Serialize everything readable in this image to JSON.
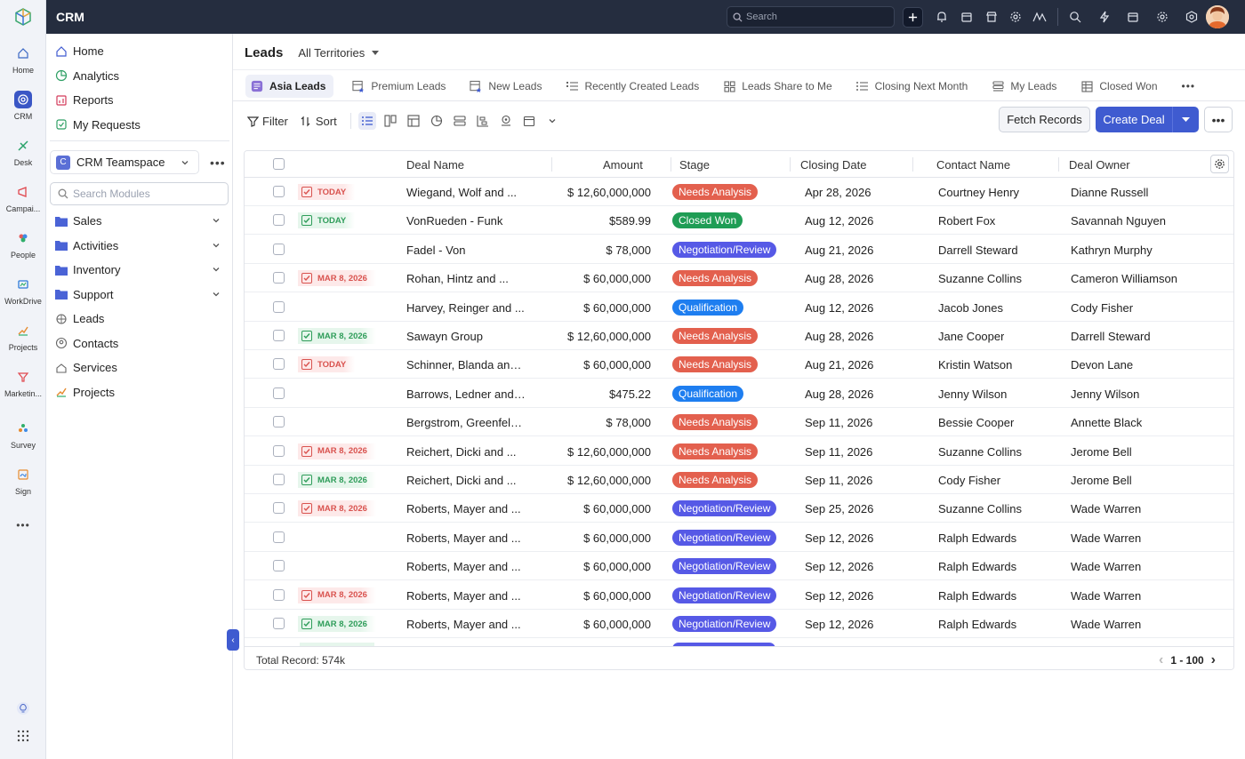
{
  "app": {
    "name": "CRM",
    "search_placeholder": "Search"
  },
  "rail": [
    {
      "label": "Home",
      "icon": "home-icon"
    },
    {
      "label": "CRM",
      "icon": "crm-icon",
      "active": true
    },
    {
      "label": "Desk",
      "icon": "desk-icon"
    },
    {
      "label": "Campai...",
      "icon": "campaigns-icon"
    },
    {
      "label": "People",
      "icon": "people-icon"
    },
    {
      "label": "WorkDrive",
      "icon": "workdrive-icon"
    },
    {
      "label": "Projects",
      "icon": "projects-icon"
    },
    {
      "label": "Marketin...",
      "icon": "marketing-icon"
    },
    {
      "label": "Survey",
      "icon": "survey-icon"
    },
    {
      "label": "Sign",
      "icon": "sign-icon"
    }
  ],
  "sidebar": {
    "top_items": [
      {
        "label": "Home",
        "icon": "home-icon"
      },
      {
        "label": "Analytics",
        "icon": "analytics-icon"
      },
      {
        "label": "Reports",
        "icon": "reports-icon"
      },
      {
        "label": "My Requests",
        "icon": "requests-icon"
      }
    ],
    "teamspace": {
      "badge": "C",
      "name": "CRM Teamspace"
    },
    "search_placeholder": "Search Modules",
    "folders": [
      {
        "label": "Sales"
      },
      {
        "label": "Activities"
      },
      {
        "label": "Inventory"
      },
      {
        "label": "Support"
      }
    ],
    "modules": [
      {
        "label": "Leads",
        "icon": "leads-icon"
      },
      {
        "label": "Contacts",
        "icon": "contacts-icon"
      },
      {
        "label": "Services",
        "icon": "services-icon"
      },
      {
        "label": "Projects",
        "icon": "projects-icon"
      }
    ]
  },
  "header": {
    "title": "Leads",
    "territory": "All Territories"
  },
  "tabs": [
    {
      "label": "Asia Leads",
      "active": true
    },
    {
      "label": "Premium Leads"
    },
    {
      "label": "New Leads"
    },
    {
      "label": "Recently Created Leads"
    },
    {
      "label": "Leads Share to Me"
    },
    {
      "label": "Closing Next Month"
    },
    {
      "label": "My Leads"
    },
    {
      "label": "Closed Won"
    }
  ],
  "toolbar": {
    "filter": "Filter",
    "sort": "Sort",
    "fetch": "Fetch Records",
    "create": "Create Deal"
  },
  "columns": {
    "deal_name": "Deal Name",
    "amount": "Amount",
    "stage": "Stage",
    "closing_date": "Closing Date",
    "contact_name": "Contact Name",
    "deal_owner": "Deal Owner"
  },
  "stage_colors": {
    "Needs Analysis": "#e3604e",
    "Closed Won": "#1f9d55",
    "Negotiation/Review": "#5659e6",
    "Qualification": "#1e7ef0"
  },
  "rows": [
    {
      "tag": "TODAY",
      "tag_color": "red",
      "deal": "Wiegand, Wolf and ...",
      "amount": "$ 12,60,000,000",
      "stage": "Needs Analysis",
      "date": "Apr 28, 2026",
      "contact": "Courtney Henry",
      "owner": "Dianne Russell"
    },
    {
      "tag": "TODAY",
      "tag_color": "green",
      "deal": "VonRueden - Funk",
      "amount": "$589.99",
      "stage": "Closed Won",
      "date": "Aug 12, 2026",
      "contact": "Robert Fox",
      "owner": "Savannah Nguyen"
    },
    {
      "tag": "",
      "tag_color": "",
      "deal": "Fadel - Von",
      "amount": "$ 78,000",
      "stage": "Negotiation/Review",
      "date": "Aug 21, 2026",
      "contact": "Darrell Steward",
      "owner": "Kathryn Murphy"
    },
    {
      "tag": "MAR 8, 2026",
      "tag_color": "red",
      "deal": "Rohan, Hintz and ...",
      "amount": "$ 60,000,000",
      "stage": "Needs Analysis",
      "date": "Aug 28, 2026",
      "contact": "Suzanne Collins",
      "owner": "Cameron Williamson"
    },
    {
      "tag": "",
      "tag_color": "",
      "deal": "Harvey, Reinger and ...",
      "amount": "$ 60,000,000",
      "stage": "Qualification",
      "date": "Aug 12, 2026",
      "contact": "Jacob Jones",
      "owner": "Cody Fisher"
    },
    {
      "tag": "MAR 8, 2026",
      "tag_color": "green",
      "deal": "Sawayn Group",
      "amount": "$ 12,60,000,000",
      "stage": "Needs Analysis",
      "date": "Aug 28, 2026",
      "contact": "Jane Cooper",
      "owner": "Darrell Steward"
    },
    {
      "tag": "TODAY",
      "tag_color": "red",
      "deal": "Schinner, Blanda and ...",
      "amount": "$ 60,000,000",
      "stage": "Needs Analysis",
      "date": "Aug 21, 2026",
      "contact": "Kristin Watson",
      "owner": "Devon Lane"
    },
    {
      "tag": "",
      "tag_color": "",
      "deal": "Barrows, Ledner and ...",
      "amount": "$475.22",
      "stage": "Qualification",
      "date": "Aug 28, 2026",
      "contact": "Jenny Wilson",
      "owner": "Jenny Wilson"
    },
    {
      "tag": "",
      "tag_color": "",
      "deal": "Bergstrom, Greenfelde...",
      "amount": "$ 78,000",
      "stage": "Needs Analysis",
      "date": "Sep 11, 2026",
      "contact": "Bessie Cooper",
      "owner": "Annette Black"
    },
    {
      "tag": "MAR 8, 2026",
      "tag_color": "red",
      "deal": "Reichert, Dicki and ...",
      "amount": "$ 12,60,000,000",
      "stage": "Needs Analysis",
      "date": "Sep 11, 2026",
      "contact": "Suzanne Collins",
      "owner": "Jerome Bell"
    },
    {
      "tag": "MAR 8, 2026",
      "tag_color": "green",
      "deal": "Reichert, Dicki and ...",
      "amount": "$ 12,60,000,000",
      "stage": "Needs Analysis",
      "date": "Sep 11, 2026",
      "contact": "Cody Fisher",
      "owner": "Jerome Bell"
    },
    {
      "tag": "MAR 8, 2026",
      "tag_color": "red",
      "deal": "Roberts, Mayer and ...",
      "amount": "$ 60,000,000",
      "stage": "Negotiation/Review",
      "date": "Sep 25, 2026",
      "contact": "Suzanne Collins",
      "owner": "Wade Warren"
    },
    {
      "tag": "",
      "tag_color": "",
      "deal": "Roberts, Mayer and ...",
      "amount": "$ 60,000,000",
      "stage": "Negotiation/Review",
      "date": "Sep 12, 2026",
      "contact": "Ralph Edwards",
      "owner": "Wade Warren"
    },
    {
      "tag": "",
      "tag_color": "",
      "deal": "Roberts, Mayer and ...",
      "amount": "$ 60,000,000",
      "stage": "Negotiation/Review",
      "date": "Sep 12, 2026",
      "contact": "Ralph Edwards",
      "owner": "Wade Warren"
    },
    {
      "tag": "MAR 8, 2026",
      "tag_color": "red",
      "deal": "Roberts, Mayer and ...",
      "amount": "$ 60,000,000",
      "stage": "Negotiation/Review",
      "date": "Sep 12, 2026",
      "contact": "Ralph Edwards",
      "owner": "Wade Warren"
    },
    {
      "tag": "MAR 8, 2026",
      "tag_color": "green",
      "deal": "Roberts, Mayer and ...",
      "amount": "$ 60,000,000",
      "stage": "Negotiation/Review",
      "date": "Sep 12, 2026",
      "contact": "Ralph Edwards",
      "owner": "Wade Warren"
    }
  ],
  "footer": {
    "total": "Total Record: 574k",
    "range": "1 - 100"
  }
}
